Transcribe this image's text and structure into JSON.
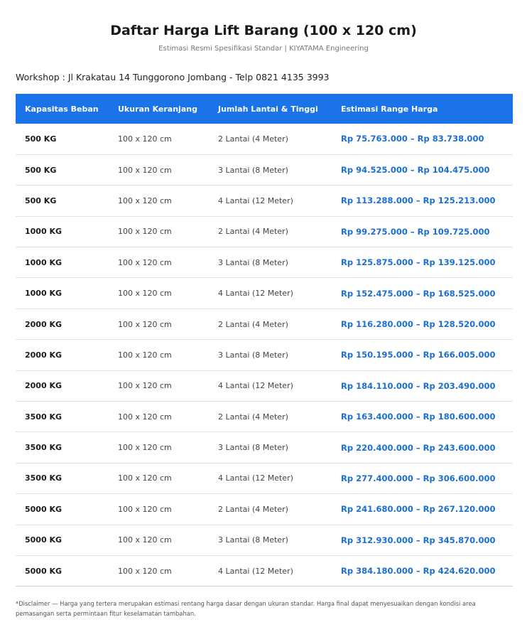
{
  "header": {
    "title": "Daftar Harga Lift Barang (100 x 120 cm)",
    "subtitle": "Estimasi Resmi Spesifikasi Standar | KIYATAMA Engineering",
    "workshop": "Workshop : Jl Krakatau 14 Tunggorono Jombang - Telp 0821 4135 3993"
  },
  "table": {
    "columns": [
      "Kapasitas Beban",
      "Ukuran Keranjang",
      "Jumlah Lantai & Tinggi",
      "Estimasi Range Harga"
    ],
    "rows": [
      [
        "500 KG",
        "100 x 120 cm",
        "2 Lantai (4 Meter)",
        "Rp 75.763.000 – Rp 83.738.000"
      ],
      [
        "500 KG",
        "100 x 120 cm",
        "3 Lantai (8 Meter)",
        "Rp 94.525.000 – Rp 104.475.000"
      ],
      [
        "500 KG",
        "100 x 120 cm",
        "4 Lantai (12 Meter)",
        "Rp 113.288.000 – Rp 125.213.000"
      ],
      [
        "1000 KG",
        "100 x 120 cm",
        "2 Lantai (4 Meter)",
        "Rp 99.275.000 – Rp 109.725.000"
      ],
      [
        "1000 KG",
        "100 x 120 cm",
        "3 Lantai (8 Meter)",
        "Rp 125.875.000 – Rp 139.125.000"
      ],
      [
        "1000 KG",
        "100 x 120 cm",
        "4 Lantai (12 Meter)",
        "Rp 152.475.000 – Rp 168.525.000"
      ],
      [
        "2000 KG",
        "100 x 120 cm",
        "2 Lantai (4 Meter)",
        "Rp 116.280.000 – Rp 128.520.000"
      ],
      [
        "2000 KG",
        "100 x 120 cm",
        "3 Lantai (8 Meter)",
        "Rp 150.195.000 – Rp 166.005.000"
      ],
      [
        "2000 KG",
        "100 x 120 cm",
        "4 Lantai (12 Meter)",
        "Rp 184.110.000 – Rp 203.490.000"
      ],
      [
        "3500 KG",
        "100 x 120 cm",
        "2 Lantai (4 Meter)",
        "Rp 163.400.000 – Rp 180.600.000"
      ],
      [
        "3500 KG",
        "100 x 120 cm",
        "3 Lantai (8 Meter)",
        "Rp 220.400.000 – Rp 243.600.000"
      ],
      [
        "3500 KG",
        "100 x 120 cm",
        "4 Lantai (12 Meter)",
        "Rp 277.400.000 – Rp 306.600.000"
      ],
      [
        "5000 KG",
        "100 x 120 cm",
        "2 Lantai (4 Meter)",
        "Rp 241.680.000 – Rp 267.120.000"
      ],
      [
        "5000 KG",
        "100 x 120 cm",
        "3 Lantai (8 Meter)",
        "Rp 312.930.000 – Rp 345.870.000"
      ],
      [
        "5000 KG",
        "100 x 120 cm",
        "4 Lantai (12 Meter)",
        "Rp 384.180.000 – Rp 424.620.000"
      ]
    ]
  },
  "footer": {
    "disclaimer": "*Disclaimer — Harga yang tertera merupakan estimasi rentang harga dasar dengan ukuran standar. Harga final dapat menyesuaikan dengan kondisi area pemasangan serta permintaan fitur keselamatan tambahan."
  },
  "colors": {
    "header_bg": "#1a73e8",
    "price_text": "#1a6fd1"
  }
}
